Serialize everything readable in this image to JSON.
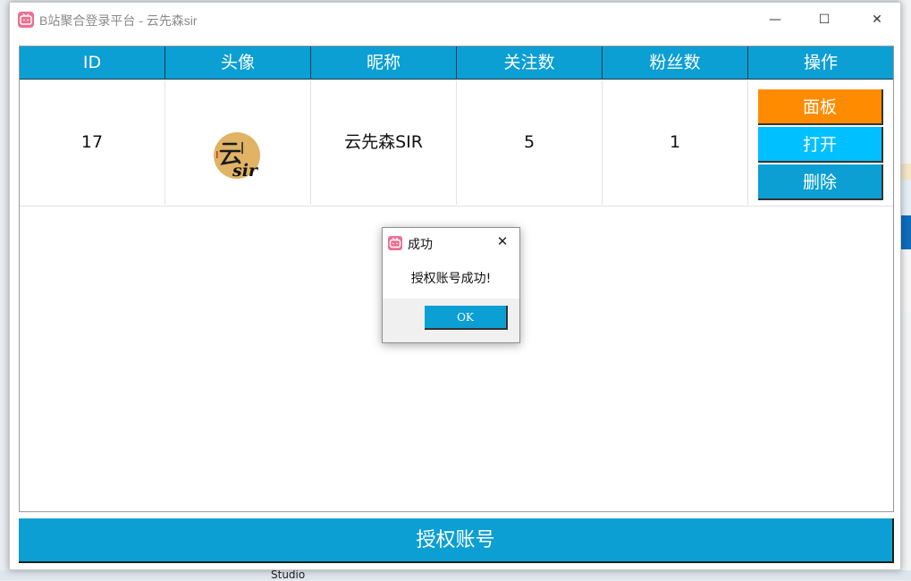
{
  "window": {
    "title": "B站聚合登录平台 - 云先森sir",
    "minimize_glyph": "—",
    "maximize_glyph": "☐",
    "close_glyph": "✕"
  },
  "table": {
    "headers": [
      "ID",
      "头像",
      "昵称",
      "关注数",
      "粉丝数",
      "操作"
    ],
    "rows": [
      {
        "id": "17",
        "avatar_text": "云sir",
        "nickname": "云先森SIR",
        "following": "5",
        "followers": "1",
        "actions": {
          "panel": "面板",
          "open": "打开",
          "delete": "删除"
        }
      }
    ]
  },
  "auth_button": "授权账号",
  "dialog": {
    "title": "成功",
    "message": "授权账号成功!",
    "ok": "OK",
    "close_glyph": "✕"
  },
  "desktop": {
    "taskbar_text": "Studio"
  },
  "colors": {
    "header": "#0b9fd3",
    "panel_button": "#ff8c00",
    "open_button": "#00c0ff",
    "delete_button": "#0b9fd3",
    "app_icon": "#ec6f92"
  },
  "icons": {
    "app": "bilibili-tv-icon",
    "avatar": "yun-sir-logo"
  }
}
